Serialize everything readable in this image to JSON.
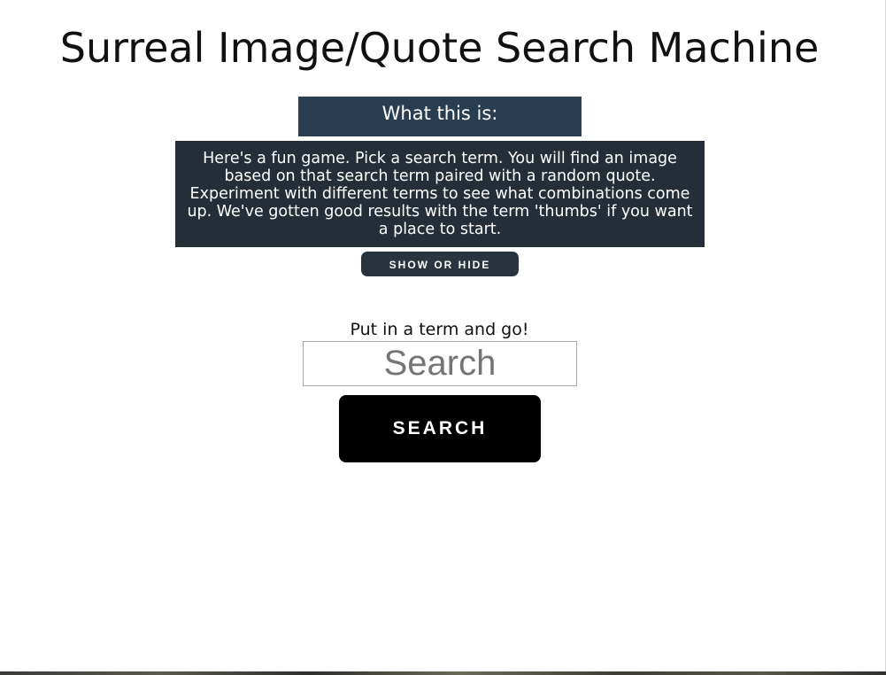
{
  "page": {
    "title": "Surreal Image/Quote Search Machine"
  },
  "about": {
    "header": "What this is:",
    "body": "Here's a fun game. Pick a search term. You will find an image based on that search term paired with a random quote. Experiment with different terms to see what combinations come up. We've gotten good results with the term 'thumbs' if you want a place to start.",
    "toggle_label": "SHOW OR HIDE"
  },
  "search": {
    "prompt": "Put in a term and go!",
    "placeholder": "Search",
    "value": "",
    "button_label": "SEARCH"
  },
  "colors": {
    "about_header_bg": "#2a3e52",
    "about_body_bg": "#252e38",
    "toggle_bg": "#2a3340",
    "search_button_bg": "#000000"
  }
}
